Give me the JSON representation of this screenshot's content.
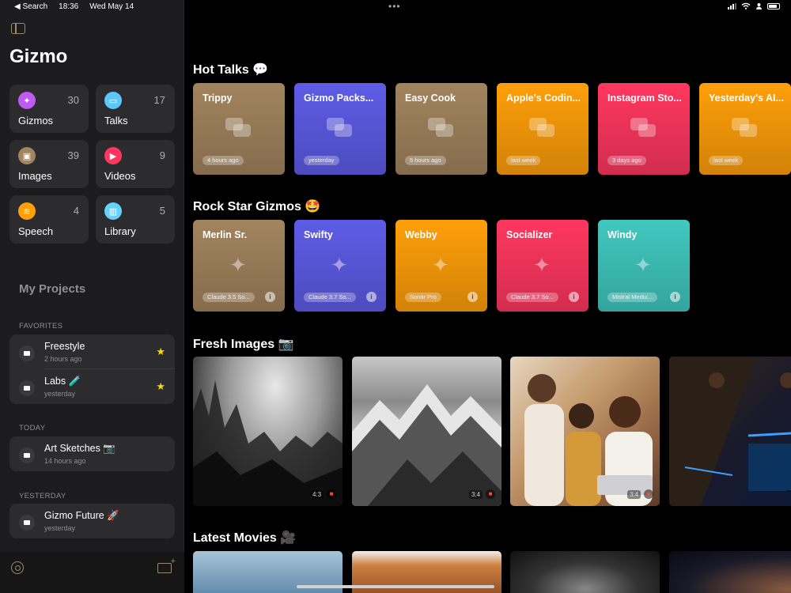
{
  "status_bar": {
    "back": "◀ Search",
    "time": "18:36",
    "date": "Wed May 14"
  },
  "sidebar": {
    "title": "Gizmo",
    "tiles": [
      {
        "label": "Gizmos",
        "count": "30",
        "color": "#bf5af2",
        "icon": "sparkle-icon"
      },
      {
        "label": "Talks",
        "count": "17",
        "color": "#5ac8fa",
        "icon": "chat-icon"
      },
      {
        "label": "Images",
        "count": "39",
        "color": "#a2845e",
        "icon": "photo-icon"
      },
      {
        "label": "Videos",
        "count": "9",
        "color": "#ff375f",
        "icon": "clapper-icon"
      },
      {
        "label": "Speech",
        "count": "4",
        "color": "#ff9f0a",
        "icon": "waveform-icon"
      },
      {
        "label": "Library",
        "count": "5",
        "color": "#64d2ff",
        "icon": "books-icon"
      }
    ],
    "my_projects": "My Projects",
    "sections": [
      {
        "header": "FAVORITES",
        "items": [
          {
            "title": "Freestyle",
            "sub": "2 hours ago",
            "star": "★"
          },
          {
            "title": "Labs 🧪",
            "sub": "yesterday",
            "star": "★"
          }
        ]
      },
      {
        "header": "TODAY",
        "items": [
          {
            "title": "Art Sketches 📷",
            "sub": "14 hours ago"
          }
        ]
      },
      {
        "header": "YESTERDAY",
        "items": [
          {
            "title": "Gizmo Future 🚀",
            "sub": "yesterday"
          }
        ]
      }
    ]
  },
  "main": {
    "hot_talks": {
      "title": "Hot Talks 💬",
      "cards": [
        {
          "title": "Trippy",
          "tag": "4 hours ago",
          "color": "#a2845e"
        },
        {
          "title": "Gizmo Packs...",
          "tag": "yesterday",
          "color": "#5e5ce6"
        },
        {
          "title": "Easy Cook",
          "tag": "5 hours ago",
          "color": "#a2845e"
        },
        {
          "title": "Apple's Codin...",
          "tag": "last week",
          "color": "#ff9f0a"
        },
        {
          "title": "Instagram Sto...",
          "tag": "3 days ago",
          "color": "#ff375f"
        },
        {
          "title": "Yesterday's AI...",
          "tag": "last week",
          "color": "#ff9f0a"
        }
      ]
    },
    "rock_star": {
      "title": "Rock Star Gizmos 🤩",
      "cards": [
        {
          "title": "Merlin Sr.",
          "tag": "Claude 3.5 So...",
          "color": "#a2845e"
        },
        {
          "title": "Swifty",
          "tag": "Claude 3.7 So...",
          "color": "#5e5ce6"
        },
        {
          "title": "Webby",
          "tag": "Sonar Pro",
          "color": "#ff9f0a"
        },
        {
          "title": "Socializer",
          "tag": "Claude 3.7 So...",
          "color": "#ff375f"
        },
        {
          "title": "Windy",
          "tag": "Mistral Mediu...",
          "color": "#40c8c0"
        }
      ]
    },
    "fresh_images": {
      "title": "Fresh Images 📷",
      "items": [
        {
          "ratio": "4:3"
        },
        {
          "ratio": "3:4"
        },
        {
          "ratio": "3:4"
        },
        {
          "ratio": ""
        }
      ]
    },
    "latest_movies": {
      "title": "Latest Movies 🎥"
    }
  }
}
